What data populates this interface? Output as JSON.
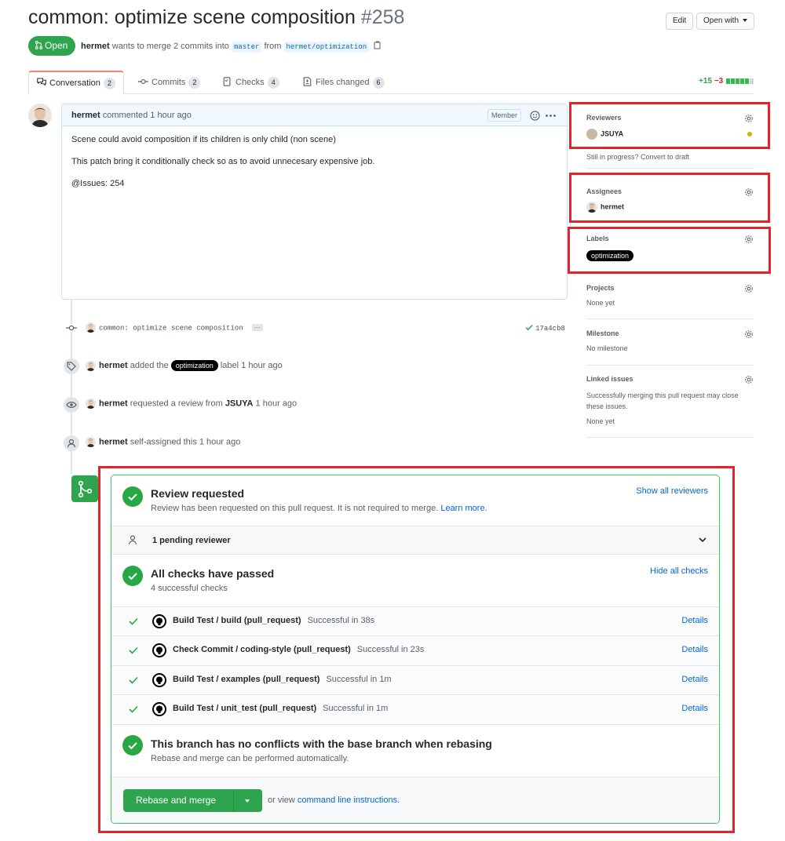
{
  "header": {
    "title": "common: optimize scene composition",
    "number": "#258",
    "edit_label": "Edit",
    "open_with_label": "Open with",
    "state": "Open",
    "author": "hermet",
    "merge_text": "wants to merge 2 commits into",
    "base_branch": "master",
    "from_text": "from",
    "head_branch": "hermet/optimization"
  },
  "tabs": [
    {
      "label": "Conversation",
      "count": "2"
    },
    {
      "label": "Commits",
      "count": "2"
    },
    {
      "label": "Checks",
      "count": "4"
    },
    {
      "label": "Files changed",
      "count": "6"
    }
  ],
  "diffstat": {
    "additions": "+15",
    "deletions": "−3"
  },
  "comment": {
    "author": "hermet",
    "action": "commented",
    "time": "1 hour ago",
    "badge": "Member",
    "body": [
      "Scene could avoid composition if its children is only child (non scene)",
      "This patch bring it conditionally check so as to avoid unnecesary expensive job.",
      "@Issues: 254"
    ]
  },
  "timeline": {
    "commit_message": "common: optimize scene composition",
    "commit_more": "···",
    "commit_sha": "17a4cb8",
    "label_event": {
      "actor": "hermet",
      "pre": "added the",
      "label": "optimization",
      "post": "label",
      "time": "1 hour ago"
    },
    "review_event": {
      "actor": "hermet",
      "pre": "requested a review from",
      "reviewer": "JSUYA",
      "time": "1 hour ago"
    },
    "assign_event": {
      "actor": "hermet",
      "text": "self-assigned this",
      "time": "1 hour ago"
    }
  },
  "sidebar": {
    "reviewers_title": "Reviewers",
    "reviewer": "JSUYA",
    "draft_text": "Still in progress? Convert to draft",
    "assignees_title": "Assignees",
    "assignee": "hermet",
    "labels_title": "Labels",
    "label": "optimization",
    "projects_title": "Projects",
    "projects_value": "None yet",
    "milestone_title": "Milestone",
    "milestone_value": "No milestone",
    "linked_title": "Linked issues",
    "linked_desc": "Successfully merging this pull request may close these issues.",
    "linked_value": "None yet"
  },
  "merge_box": {
    "review_title": "Review requested",
    "review_desc": "Review has been requested on this pull request. It is not required to merge.",
    "learn_more": "Learn more.",
    "show_reviewers": "Show all reviewers",
    "pending": "1 pending reviewer",
    "checks_title": "All checks have passed",
    "checks_sub": "4 successful checks",
    "hide_checks": "Hide all checks",
    "checks": [
      {
        "name": "Build Test / build (pull_request)",
        "status": "Successful in 38s",
        "details": "Details"
      },
      {
        "name": "Check Commit / coding-style (pull_request)",
        "status": "Successful in 23s",
        "details": "Details"
      },
      {
        "name": "Build Test / examples (pull_request)",
        "status": "Successful in 1m",
        "details": "Details"
      },
      {
        "name": "Build Test / unit_test (pull_request)",
        "status": "Successful in 1m",
        "details": "Details"
      }
    ],
    "conflict_title": "This branch has no conflicts with the base branch when rebasing",
    "conflict_sub": "Rebase and merge can be performed automatically.",
    "merge_button": "Rebase and merge",
    "or_view": "or view",
    "cli_link": "command line instructions."
  },
  "colors": {
    "accent_green": "#2ea44f",
    "highlight_red": "#e2252b",
    "link_blue": "#0366d6"
  }
}
